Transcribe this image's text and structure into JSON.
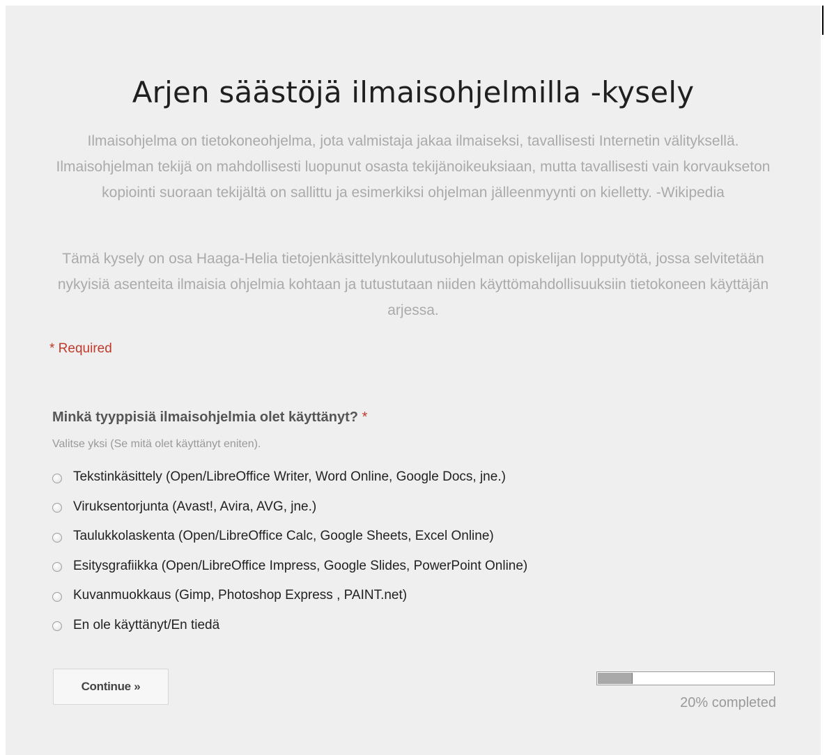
{
  "form": {
    "title": "Arjen säästöjä ilmaisohjelmilla -kysely",
    "description_1": "Ilmaisohjelma on tietokoneohjelma, jota valmistaja jakaa ilmaiseksi, tavallisesti Internetin välityksellä. Ilmaisohjelman tekijä on mahdollisesti luopunut osasta tekijänoikeuksiaan, mutta tavallisesti vain korvaukseton kopiointi suoraan tekijältä on sallittu ja esimerkiksi ohjelman jälleenmyynti on kielletty. -Wikipedia",
    "description_2": "Tämä kysely on osa Haaga-Helia tietojenkäsittelynkoulutusohjelman opiskelijan lopputyötä, jossa selvitetään nykyisiä asenteita ilmaisia ohjelmia kohtaan ja tutustutaan niiden käyttömahdollisuuksiin tietokoneen käyttäjän arjessa.",
    "required_note": "* Required"
  },
  "question": {
    "title": "Minkä tyyppisiä ilmaisohjelmia olet käyttänyt?",
    "required_marker": "*",
    "help_text": "Valitse yksi (Se mitä olet käyttänyt eniten).",
    "options": [
      {
        "label": "Tekstinkäsittely (Open/LibreOffice Writer, Word Online, Google Docs, jne.)",
        "selected": false
      },
      {
        "label": "Viruksentorjunta (Avast!, Avira, AVG, jne.)",
        "selected": false
      },
      {
        "label": "Taulukkolaskenta (Open/LibreOffice Calc, Google Sheets, Excel Online)",
        "selected": false
      },
      {
        "label": "Esitysgrafiikka (Open/LibreOffice Impress, Google Slides, PowerPoint Online)",
        "selected": false
      },
      {
        "label": "Kuvanmuokkaus (Gimp, Photoshop Express , PAINT.net)",
        "selected": false
      },
      {
        "label": "En ole käyttänyt/En tiedä",
        "selected": false
      }
    ]
  },
  "navigation": {
    "continue_label": "Continue »"
  },
  "progress": {
    "percent": 20,
    "label": "20% completed"
  },
  "colors": {
    "required_red": "#c0392b",
    "description_gray": "#aaaaaa",
    "page_background": "#efefef",
    "progress_fill": "#a9a9a9"
  },
  "icons": {
    "radio": "radio-button-icon"
  }
}
